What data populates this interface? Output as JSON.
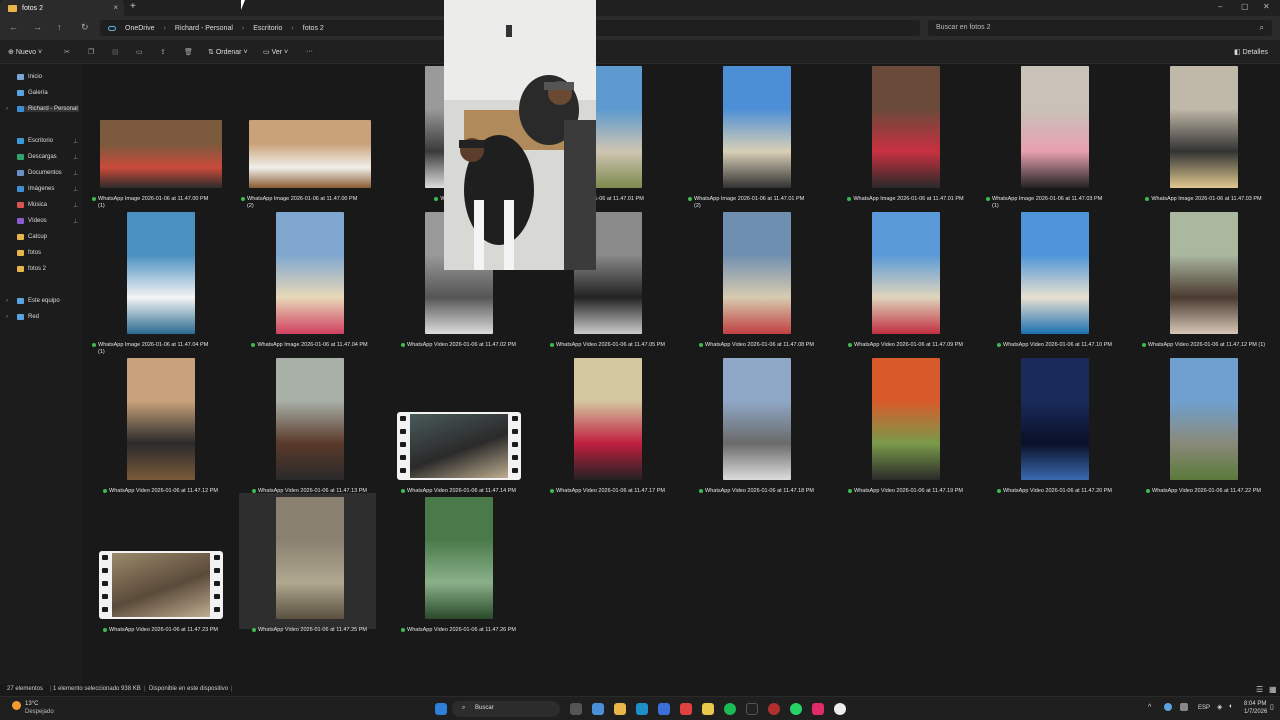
{
  "window": {
    "tab_title": "fotos 2",
    "tab_close": "×",
    "new_tab": "+",
    "win_min": "–",
    "win_max": "▢",
    "win_close": "✕"
  },
  "address": {
    "breadcrumbs": [
      "OneDrive",
      "Richard - Personal",
      "Escritorio",
      "fotos 2"
    ],
    "search_placeholder": "Buscar en fotos 2"
  },
  "commands": {
    "new": "Nuevo",
    "sort": "Ordenar",
    "view": "Ver",
    "more": "···",
    "details": "Detalles"
  },
  "sidebar": {
    "items": [
      {
        "label": "Inicio",
        "color": "#7aa7d8"
      },
      {
        "label": "Galería",
        "color": "#5aa3e0"
      },
      {
        "label": "Richard - Personal",
        "color": "#3b8fd6"
      },
      {
        "label": "Escritorio",
        "color": "#3a9ad9"
      },
      {
        "label": "Descargas",
        "color": "#2fa36b"
      },
      {
        "label": "Documentos",
        "color": "#6c8fc7"
      },
      {
        "label": "Imágenes",
        "color": "#3f8fd2"
      },
      {
        "label": "Música",
        "color": "#d9534f"
      },
      {
        "label": "Vídeos",
        "color": "#8a5cd0"
      },
      {
        "label": "Catcup",
        "color": "#e8b64a"
      },
      {
        "label": "fotos",
        "color": "#e8b64a"
      },
      {
        "label": "fotos 2",
        "color": "#e8b64a"
      },
      {
        "label": "Este equipo",
        "color": "#5aa3e0"
      },
      {
        "label": "Red",
        "color": "#5aa3e0"
      }
    ]
  },
  "files": [
    {
      "name": "WhatsApp Image 2026-01-06 at 11.47.00 PM",
      "sub": "(1)"
    },
    {
      "name": "WhatsApp Image 2026-01-06 at 11.47.00 PM",
      "sub": "(2)"
    },
    {
      "name": "WhatsApp Image",
      "sub": ""
    },
    {
      "name": "2026-01-06 at 11.47.01 PM",
      "sub": ""
    },
    {
      "name": "WhatsApp Image 2026-01-06 at 11.47.01 PM",
      "sub": "(2)"
    },
    {
      "name": "WhatsApp Image 2026-01-06 at 11.47.01 PM",
      "sub": ""
    },
    {
      "name": "WhatsApp Image 2026-01-06 at 11.47.03 PM",
      "sub": "(1)"
    },
    {
      "name": "WhatsApp Image 2026-01-06 at 11.47.03 PM",
      "sub": ""
    },
    {
      "name": "WhatsApp Image 2026-01-06 at 11.47.04 PM",
      "sub": "(1)"
    },
    {
      "name": "WhatsApp Image 2026-01-06 at 11.47.04 PM",
      "sub": ""
    },
    {
      "name": "WhatsApp Video 2026-01-06 at 11.47.02 PM",
      "sub": ""
    },
    {
      "name": "WhatsApp Video 2026-01-06 at 11.47.05 PM",
      "sub": ""
    },
    {
      "name": "WhatsApp Video 2026-01-06 at 11.47.08 PM",
      "sub": ""
    },
    {
      "name": "WhatsApp Video 2026-01-06 at 11.47.09 PM",
      "sub": ""
    },
    {
      "name": "WhatsApp Video 2026-01-06 at 11.47.10 PM",
      "sub": ""
    },
    {
      "name": "WhatsApp Video 2026-01-06 at 11.47.12 PM (1)",
      "sub": ""
    },
    {
      "name": "WhatsApp Video 2026-01-06 at 11.47.12 PM",
      "sub": ""
    },
    {
      "name": "WhatsApp Video 2026-01-06 at 11.47.13 PM",
      "sub": ""
    },
    {
      "name": "WhatsApp Video 2026-01-06 at 11.47.14 PM",
      "sub": ""
    },
    {
      "name": "WhatsApp Video 2026-01-06 at 11.47.17 PM",
      "sub": ""
    },
    {
      "name": "WhatsApp Video 2026-01-06 at 11.47.18 PM",
      "sub": ""
    },
    {
      "name": "WhatsApp Video 2026-01-06 at 11.47.19 PM",
      "sub": ""
    },
    {
      "name": "WhatsApp Video 2026-01-06 at 11.47.20 PM",
      "sub": ""
    },
    {
      "name": "WhatsApp Video 2026-01-06 at 11.47.22 PM",
      "sub": ""
    },
    {
      "name": "WhatsApp Video 2026-01-06 at 11.47.23 PM",
      "sub": ""
    },
    {
      "name": "WhatsApp Video 2026-01-06 at 11.47.25 PM",
      "sub": ""
    },
    {
      "name": "WhatsApp Video 2026-01-06 at 11.47.26 PM",
      "sub": ""
    }
  ],
  "status": {
    "count": "27 elementos",
    "selection": "1 elemento seleccionado  938 KB",
    "availability": "Disponible en este dispositivo"
  },
  "taskbar": {
    "weather_temp": "13°C",
    "weather_desc": "Despejado",
    "search": "Buscar",
    "lang": "ESP",
    "time": "8:04 PM",
    "date": "1/7/2026"
  }
}
